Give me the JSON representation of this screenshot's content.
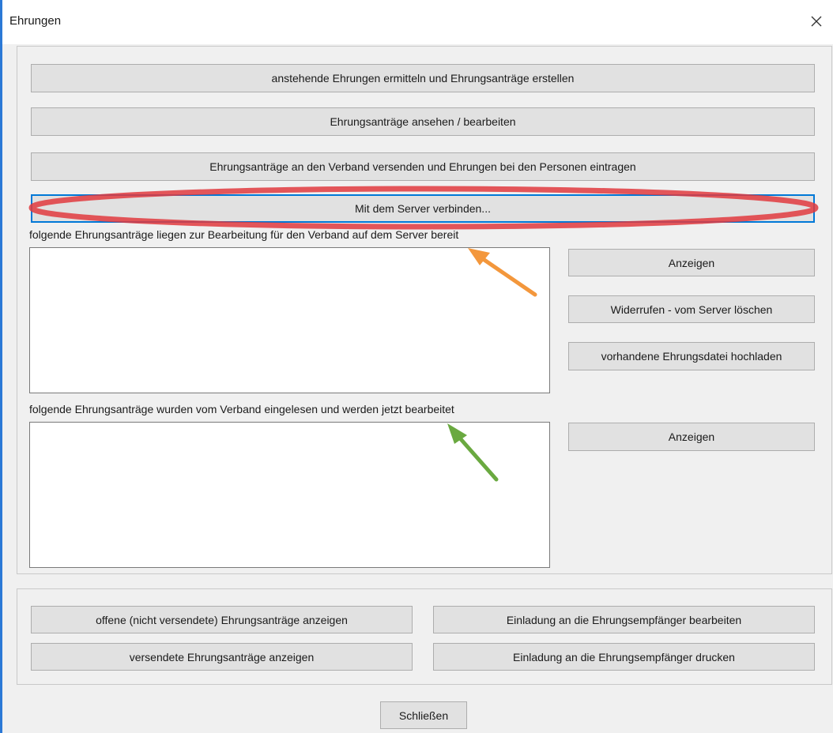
{
  "window": {
    "title": "Ehrungen",
    "close_icon": "close-icon"
  },
  "top_panel": {
    "buttons": {
      "determine": "anstehende Ehrungen ermitteln und Ehrungsanträge erstellen",
      "view_edit": "Ehrungsanträge ansehen / bearbeiten",
      "send": "Ehrungsanträge an den Verband versenden und Ehrungen bei den Personen eintragen",
      "connect": "Mit dem Server verbinden..."
    },
    "pending_section": {
      "label": "folgende Ehrungsanträge liegen zur Bearbeitung für den Verband auf dem Server bereit",
      "items": [],
      "show_button": "Anzeigen",
      "revoke_button": "Widerrufen - vom Server löschen",
      "upload_button": "vorhandene Ehrungsdatei hochladen"
    },
    "processing_section": {
      "label": "folgende Ehrungsanträge wurden vom Verband eingelesen und werden jetzt bearbeitet",
      "items": [],
      "show_button": "Anzeigen"
    }
  },
  "bottom_panel": {
    "open_requests": "offene (nicht versendete) Ehrungsanträge anzeigen",
    "sent_requests": "versendete Ehrungsanträge anzeigen",
    "edit_invitation": "Einladung an die Ehrungsempfänger bearbeiten",
    "print_invitation": "Einladung an die Ehrungsempfänger drucken"
  },
  "footer": {
    "close_button": "Schließen"
  },
  "annotations": {
    "ellipse_color": "#e0393e",
    "orange_arrow_color": "#f28c28",
    "green_arrow_color": "#5aa02c"
  }
}
